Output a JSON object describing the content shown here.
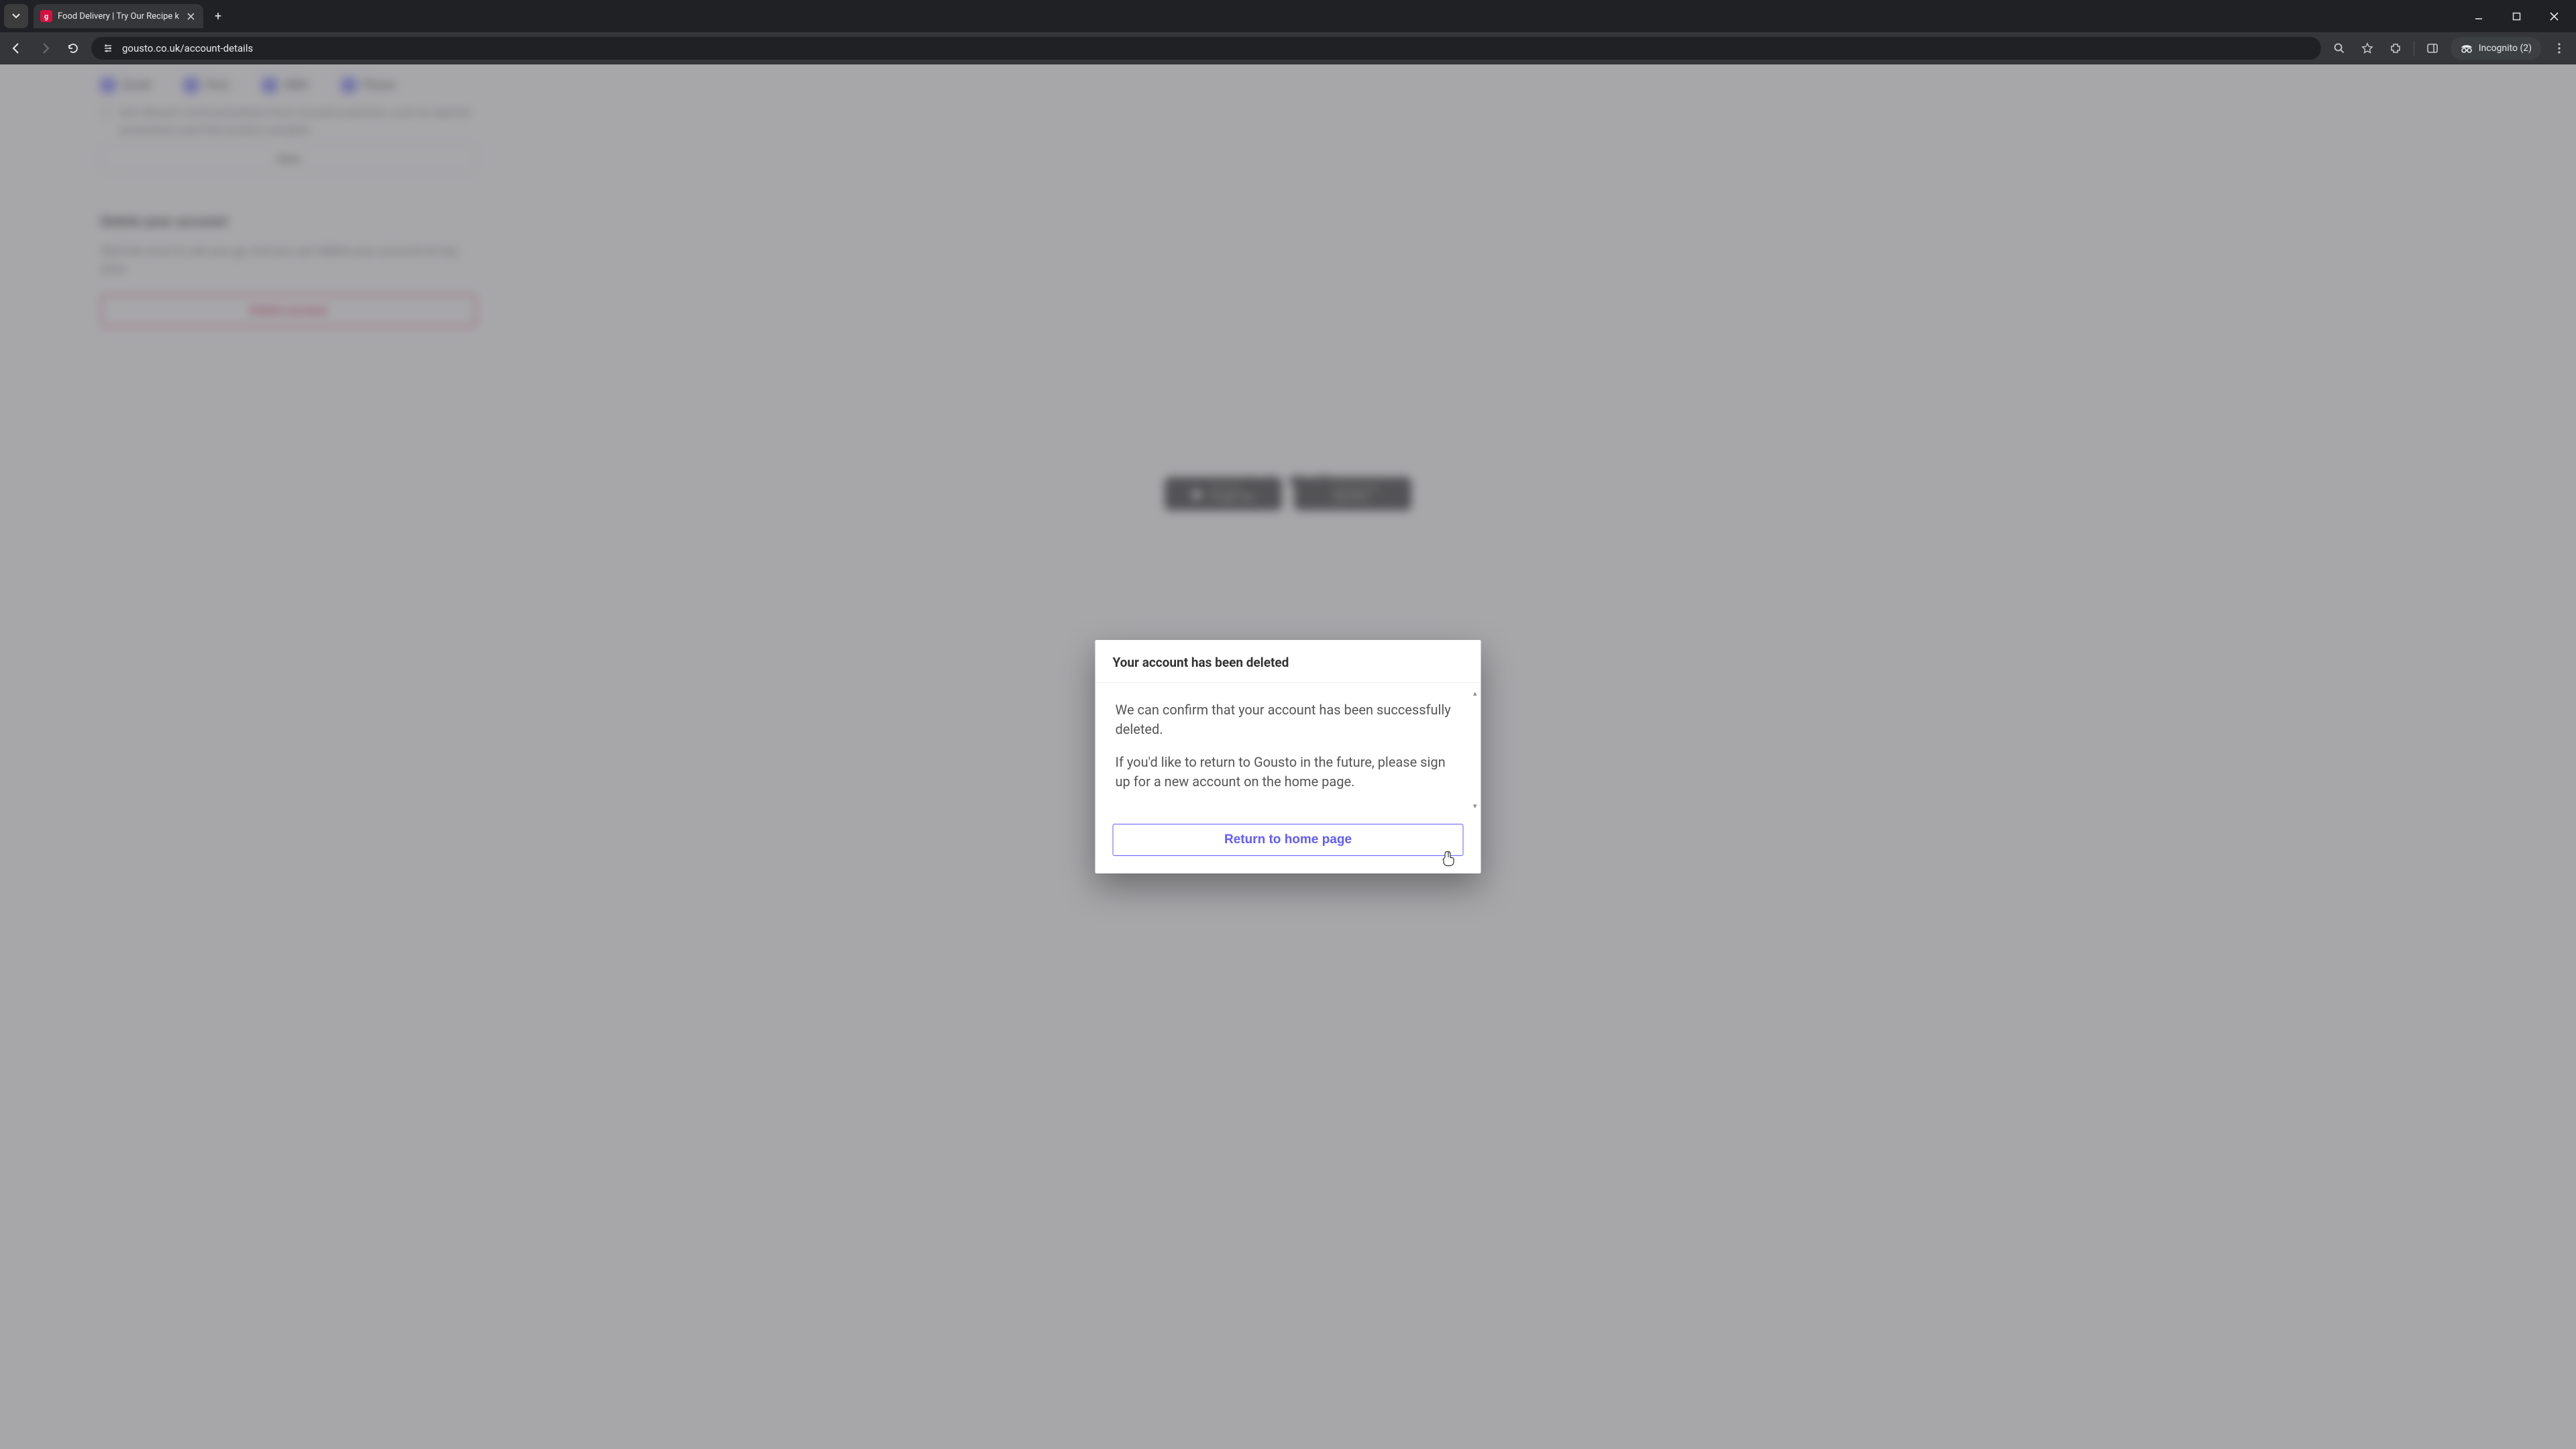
{
  "browser": {
    "tab_title": "Food Delivery | Try Our Recipe k",
    "favicon_letter": "g",
    "url": "gousto.co.uk/account-details",
    "incognito_label": "Incognito (2)"
  },
  "background_page": {
    "preferences": {
      "checkboxes": [
        {
          "label": "Email",
          "checked": true
        },
        {
          "label": "Post",
          "checked": true
        },
        {
          "label": "SMS",
          "checked": true
        },
        {
          "label": "Phone",
          "checked": true
        }
      ],
      "partner_opt_in": "Get relevant communications from Gousto's partners, such as special promotions and free product samples.",
      "save_label": "Save"
    },
    "delete_section": {
      "heading": "Delete your account",
      "body": "We'd be sorry to see you go, but you can delete your account at any time.",
      "button": "Delete account"
    },
    "footer": {
      "store_google": {
        "top": "GET IT ON",
        "bottom": "Google Play"
      },
      "store_apple": {
        "top": "Download on the",
        "bottom": "App Store"
      }
    }
  },
  "modal": {
    "title": "Your account has been deleted",
    "body_p1": "We can confirm that your account has been successfully deleted.",
    "body_p2": "If you'd like to return to Gousto in the future, please sign up for a new account on the home page.",
    "button": "Return to home page"
  }
}
